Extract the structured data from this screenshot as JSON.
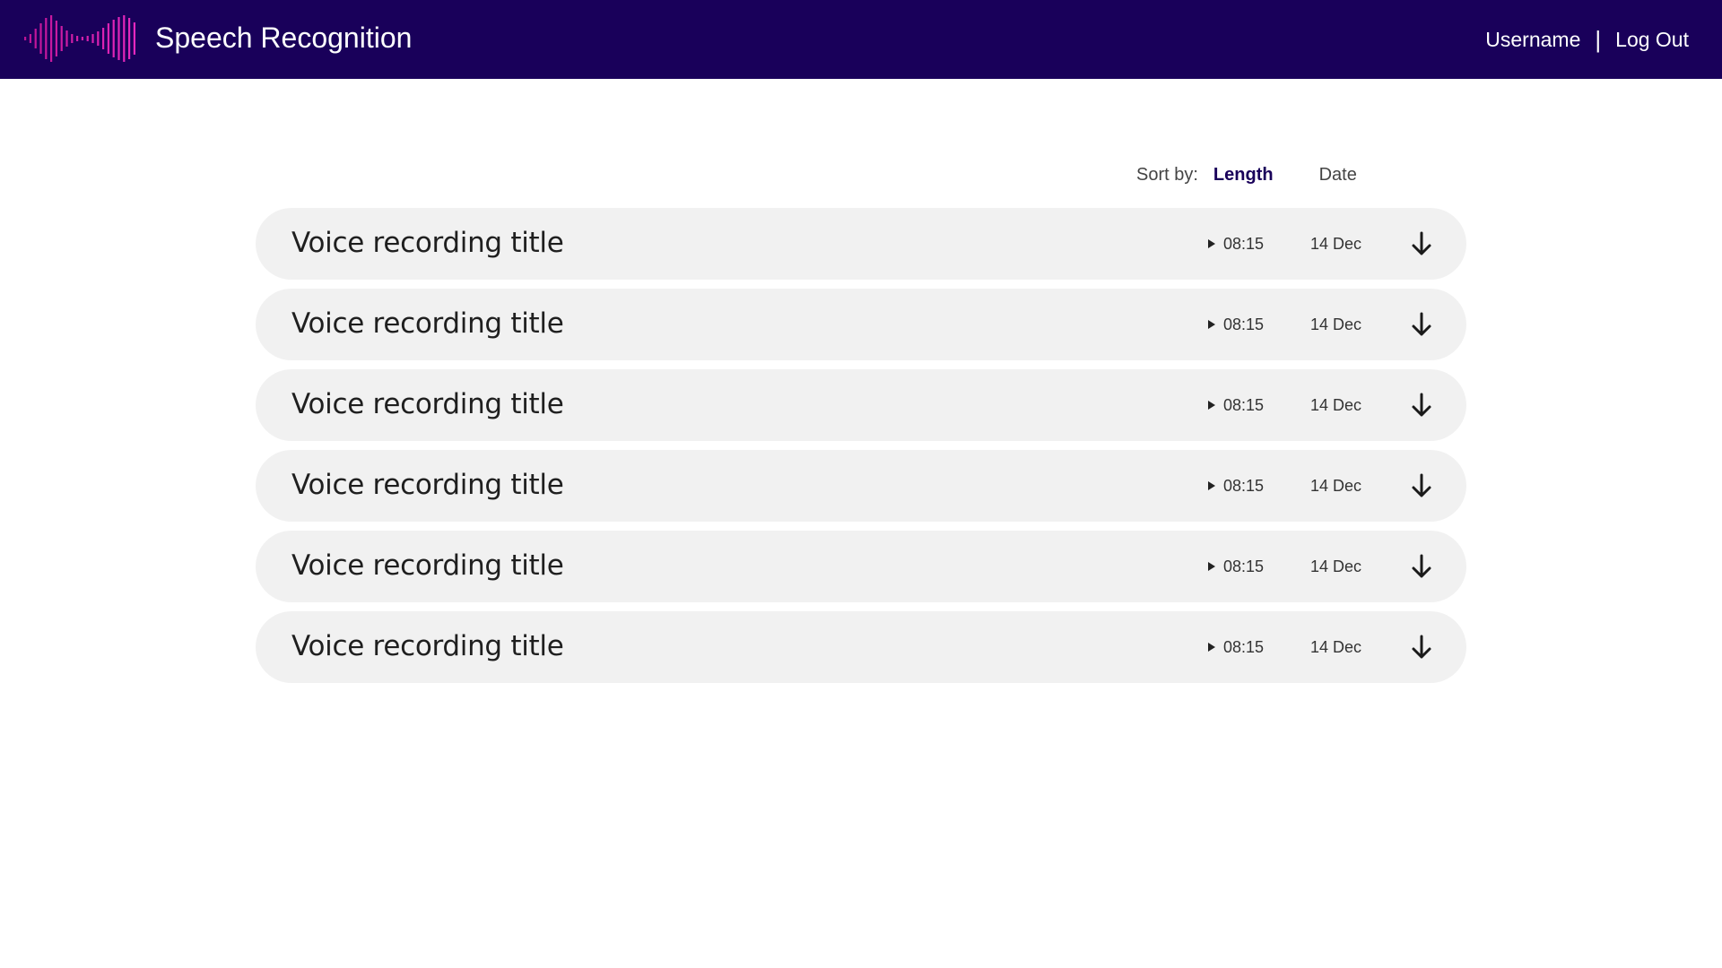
{
  "app": {
    "title": "Speech Recognition",
    "logo_icon": "waveform-icon",
    "brand_color": "#19005a",
    "accent_color": "#e0229e"
  },
  "user_nav": {
    "username": "Username",
    "separator": "|",
    "logout": "Log Out"
  },
  "sort": {
    "label": "Sort by:",
    "options": [
      "Length",
      "Date"
    ],
    "active": "Length"
  },
  "recordings": [
    {
      "title": "Voice recording title",
      "length": "08:15",
      "date": "14 Dec"
    },
    {
      "title": "Voice recording title",
      "length": "08:15",
      "date": "14 Dec"
    },
    {
      "title": "Voice recording title",
      "length": "08:15",
      "date": "14 Dec"
    },
    {
      "title": "Voice recording title",
      "length": "08:15",
      "date": "14 Dec"
    },
    {
      "title": "Voice recording title",
      "length": "08:15",
      "date": "14 Dec"
    },
    {
      "title": "Voice recording title",
      "length": "08:15",
      "date": "14 Dec"
    }
  ],
  "icons": {
    "play": "play-icon",
    "download": "download-arrow-icon"
  }
}
